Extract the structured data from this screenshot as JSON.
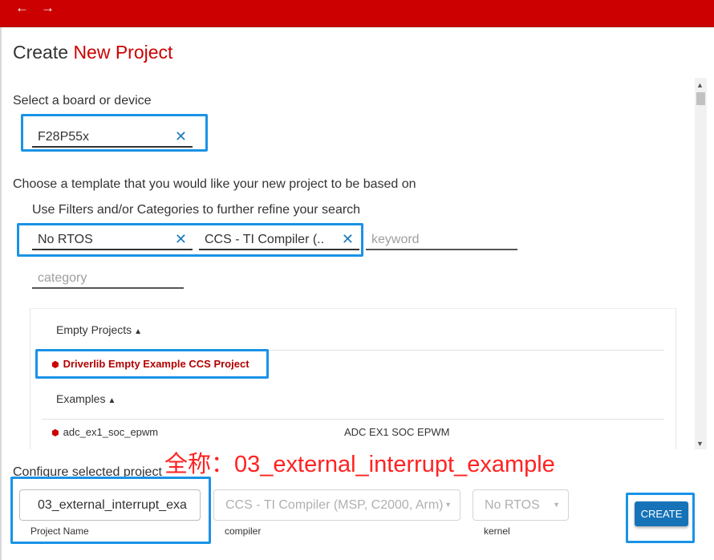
{
  "nav": {
    "back_icon": "←",
    "forward_icon": "→"
  },
  "title": {
    "prefix": "Create",
    "accent": "New Project"
  },
  "board": {
    "label": "Select a board or device",
    "value": "F28P55x",
    "clear_icon": "✕"
  },
  "template": {
    "label": "Choose a template that you would like your new project to be based on",
    "filter_label": "Use Filters and/or Categories to further refine your search",
    "filters": [
      {
        "value": "No RTOS",
        "clear_icon": "✕"
      },
      {
        "value": "CCS - TI Compiler (...",
        "clear_icon": "✕"
      }
    ],
    "keyword_placeholder": "keyword",
    "category_placeholder": "category"
  },
  "list": {
    "empty_projects_header": "Empty Projects",
    "examples_header": "Examples",
    "caret_icon": "▲",
    "cube_icon": "⬢",
    "selected_project": "Driverlib Empty Example CCS Project",
    "example_row": {
      "name": "adc_ex1_soc_epwm",
      "description": "ADC EX1 SOC EPWM"
    }
  },
  "scrollbar": {
    "up_icon": "▲",
    "down_icon": "▼"
  },
  "overlay_text": "全称：03_external_interrupt_example",
  "configure": {
    "label": "Configure selected project",
    "project_name_value": "03_external_interrupt_exa",
    "project_name_label": "Project Name",
    "compiler_value": "CCS - TI Compiler (MSP, C2000, Arm)",
    "compiler_label": "compiler",
    "kernel_value": "No RTOS",
    "kernel_label": "kernel",
    "select_arrow_icon": "▼",
    "create_label": "CREATE"
  },
  "colors": {
    "brand_red": "#cc0000",
    "highlight_blue": "#1a93e6",
    "button_blue": "#1673b8",
    "annotation_red": "#ff2222"
  }
}
